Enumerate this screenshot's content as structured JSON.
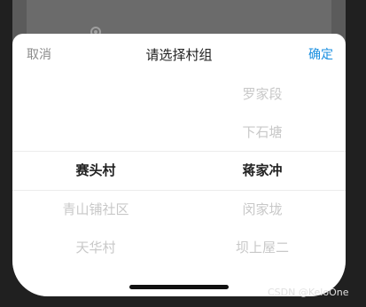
{
  "header": {
    "cancel_label": "取消",
    "title": "请选择村组",
    "confirm_label": "确定"
  },
  "picker": {
    "left_column": {
      "items": [
        "",
        "",
        "赛头村",
        "青山铺社区",
        "天华村"
      ],
      "selected_index": 2
    },
    "right_column": {
      "items": [
        "罗家段",
        "下石塘",
        "蒋家冲",
        "闵家垅",
        "坝上屋二"
      ],
      "selected_index": 2
    }
  },
  "colors": {
    "accent": "#1a8fe0",
    "selected_text": "#222222",
    "unselected_text": "#c8c8c8"
  },
  "watermark": "CSDN @KeloOne",
  "icons": {
    "backdrop": "gear-icon"
  }
}
